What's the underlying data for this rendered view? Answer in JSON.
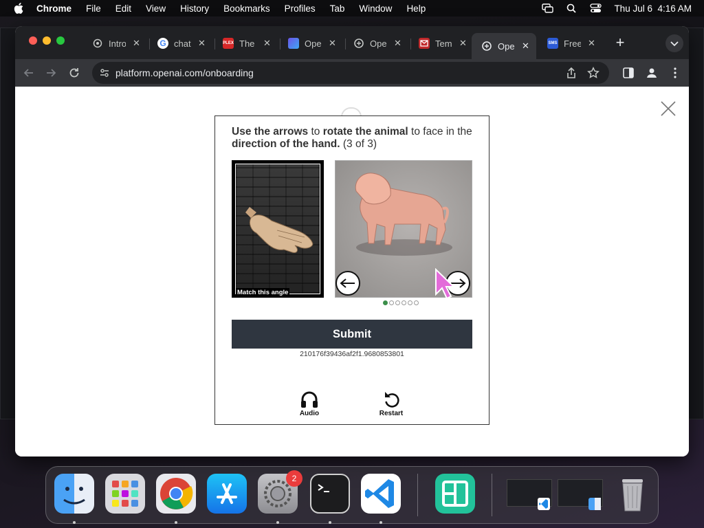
{
  "menubar": {
    "app": "Chrome",
    "items": [
      "File",
      "Edit",
      "View",
      "History",
      "Bookmarks",
      "Profiles",
      "Tab",
      "Window",
      "Help"
    ],
    "datetime": "Thu Jul 6  4:16 AM"
  },
  "tabs": [
    {
      "label": "Intro",
      "fav_color": "#3a3a3a"
    },
    {
      "label": "chat",
      "fav_color": "#ffffff"
    },
    {
      "label": "The",
      "fav_color": "#d72828",
      "fav_text": "PLEX"
    },
    {
      "label": "Ope",
      "fav_color": "#6a54e8"
    },
    {
      "label": "Ope",
      "fav_color": "#202124"
    },
    {
      "label": "Tem",
      "fav_color": "#c0282a"
    },
    {
      "label": "Ope",
      "fav_color": "#202124",
      "active": true
    },
    {
      "label": "Free",
      "fav_color": "#2d5bd6",
      "fav_text": "SMS"
    }
  ],
  "address_bar": {
    "url": "platform.openai.com/onboarding"
  },
  "captcha": {
    "instr_bold1": "Use the arrows",
    "instr_text1": " to ",
    "instr_bold2": "rotate the animal",
    "instr_text2": " to face in the ",
    "instr_bold3": "direction of the hand.",
    "instr_text3": " (3 of 3)",
    "hand_label": "Match this angle",
    "dots_total": 6,
    "dot_active": 1,
    "submit_label": "Submit",
    "session_id": "210176f39436af2f1.9680853801",
    "audio_label": "Audio",
    "restart_label": "Restart"
  },
  "dock": {
    "apps": [
      "Finder",
      "Launchpad",
      "Chrome",
      "App Store",
      "System Settings",
      "Terminal",
      "VS Code",
      "App"
    ],
    "settings_badge": "2"
  }
}
